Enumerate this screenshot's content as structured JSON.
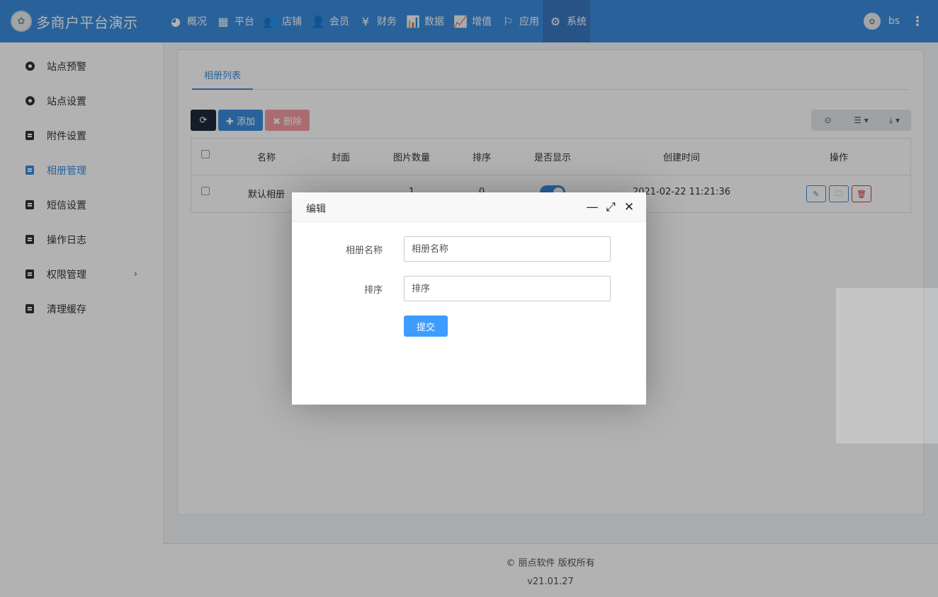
{
  "header": {
    "app_title": "多商户平台演示",
    "logo_glyph": "✿",
    "nav": [
      {
        "icon": "dashboard-icon",
        "glyph": "◕",
        "label": "概况"
      },
      {
        "icon": "grid-icon",
        "glyph": "▦",
        "label": "平台"
      },
      {
        "icon": "users-icon",
        "glyph": "👥",
        "label": "店铺"
      },
      {
        "icon": "user-plus-icon",
        "glyph": "👤",
        "label": "会员"
      },
      {
        "icon": "yen-icon",
        "glyph": "¥",
        "label": "财务"
      },
      {
        "icon": "bar-chart-icon",
        "glyph": "📊",
        "label": "数据"
      },
      {
        "icon": "line-chart-icon",
        "glyph": "📈",
        "label": "增值"
      },
      {
        "icon": "flag-icon",
        "glyph": "⚐",
        "label": "应用"
      },
      {
        "icon": "gear-icon",
        "glyph": "⚙",
        "label": "系统"
      }
    ],
    "user_name": "bs",
    "kebab": "⋮"
  },
  "sidebar": {
    "items": [
      {
        "label": "站点预警"
      },
      {
        "label": "站点设置"
      },
      {
        "label": "附件设置"
      },
      {
        "label": "相册管理"
      },
      {
        "label": "短信设置"
      },
      {
        "label": "操作日志"
      },
      {
        "label": "权限管理",
        "arrow": "›"
      },
      {
        "label": "清理缓存"
      }
    ]
  },
  "tabs": {
    "album_list": "相册列表"
  },
  "toolbar": {
    "refresh_glyph": "⟳",
    "add_label": "✚ 添加",
    "delete_label": "✖ 删除",
    "toggle_glyph": "⊙",
    "columns_glyph": "☰ ▾",
    "export_glyph": "⤓ ▾"
  },
  "table": {
    "headers": [
      "名称",
      "封面",
      "图片数量",
      "排序",
      "是否显示",
      "创建时间",
      "操作"
    ],
    "rows": [
      {
        "name": "默认相册",
        "count": "1",
        "sort": "0",
        "created": "2021-02-22 11:21:36"
      }
    ],
    "action_glyphs": {
      "edit": "✎",
      "folder": "🗀",
      "delete": "🗑"
    }
  },
  "footer": {
    "copyright": "© 丽点软件 版权所有",
    "version": "v21.01.27"
  },
  "modal": {
    "title": "编辑",
    "minimize": "—",
    "maximize": "⤢",
    "close": "✕",
    "name_label": "相册名称",
    "name_placeholder": "相册名称",
    "sort_label": "排序",
    "sort_placeholder": "排序",
    "submit_label": "提交"
  },
  "colors": {
    "primary": "#3c8dde",
    "danger": "#dc3545",
    "submit": "#3c9cff"
  }
}
